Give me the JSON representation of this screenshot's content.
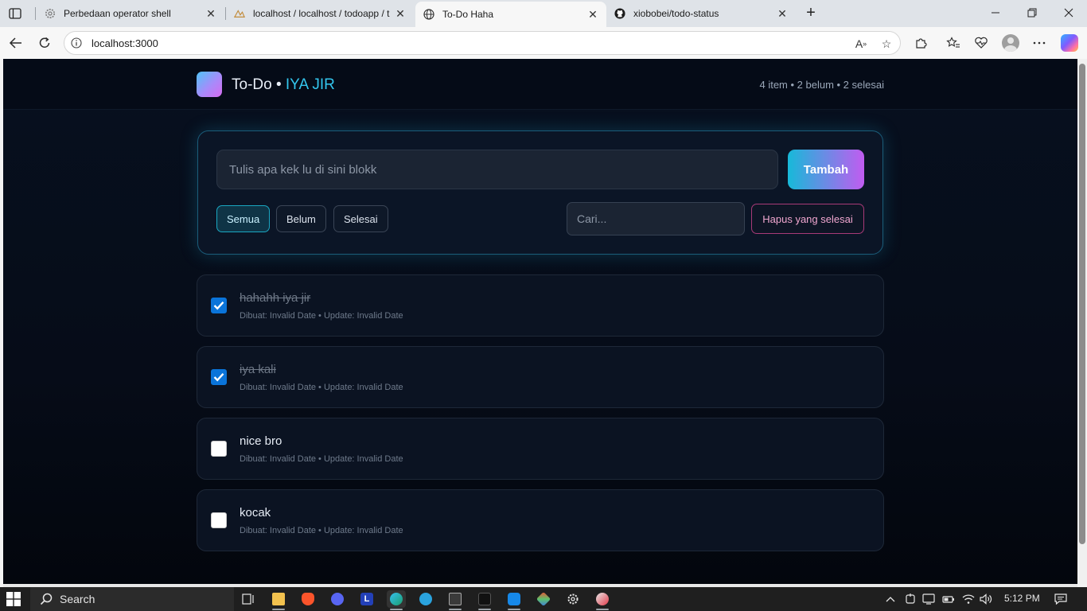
{
  "browser": {
    "tabs": [
      {
        "title": "Perbedaan operator shell",
        "icon": "gear-favicon"
      },
      {
        "title": "localhost / localhost / todoapp / t",
        "icon": "phpmyadmin-favicon"
      },
      {
        "title": "To-Do Haha",
        "icon": "globe-favicon",
        "active": true
      },
      {
        "title": "xiobobei/todo-status",
        "icon": "github-favicon"
      }
    ],
    "url": "localhost:3000"
  },
  "app": {
    "brand": "To-Do",
    "brand_sep": " • ",
    "brand_accent": "IYA JIR",
    "stats": "4 item • 2 belum • 2 selesai",
    "input_placeholder": "Tulis apa kek lu di sini blokk",
    "add_label": "Tambah",
    "filters": [
      "Semua",
      "Belum",
      "Selesai"
    ],
    "active_filter": "Semua",
    "search_placeholder": "Cari...",
    "clear_label": "Hapus yang selesai",
    "todos": [
      {
        "title": "hahahh iya jir",
        "done": true,
        "meta": "Dibuat: Invalid Date • Update: Invalid Date"
      },
      {
        "title": "iya kali",
        "done": true,
        "meta": "Dibuat: Invalid Date • Update: Invalid Date"
      },
      {
        "title": "nice bro",
        "done": false,
        "meta": "Dibuat: Invalid Date • Update: Invalid Date"
      },
      {
        "title": "kocak",
        "done": false,
        "meta": "Dibuat: Invalid Date • Update: Invalid Date"
      }
    ]
  },
  "taskbar": {
    "search_label": "Search",
    "time": "5:12 PM"
  },
  "colors": {
    "accent": "#33c6ee",
    "gradient_start": "#17b9d9",
    "gradient_end": "#c15cf0",
    "danger": "#a83a78"
  }
}
